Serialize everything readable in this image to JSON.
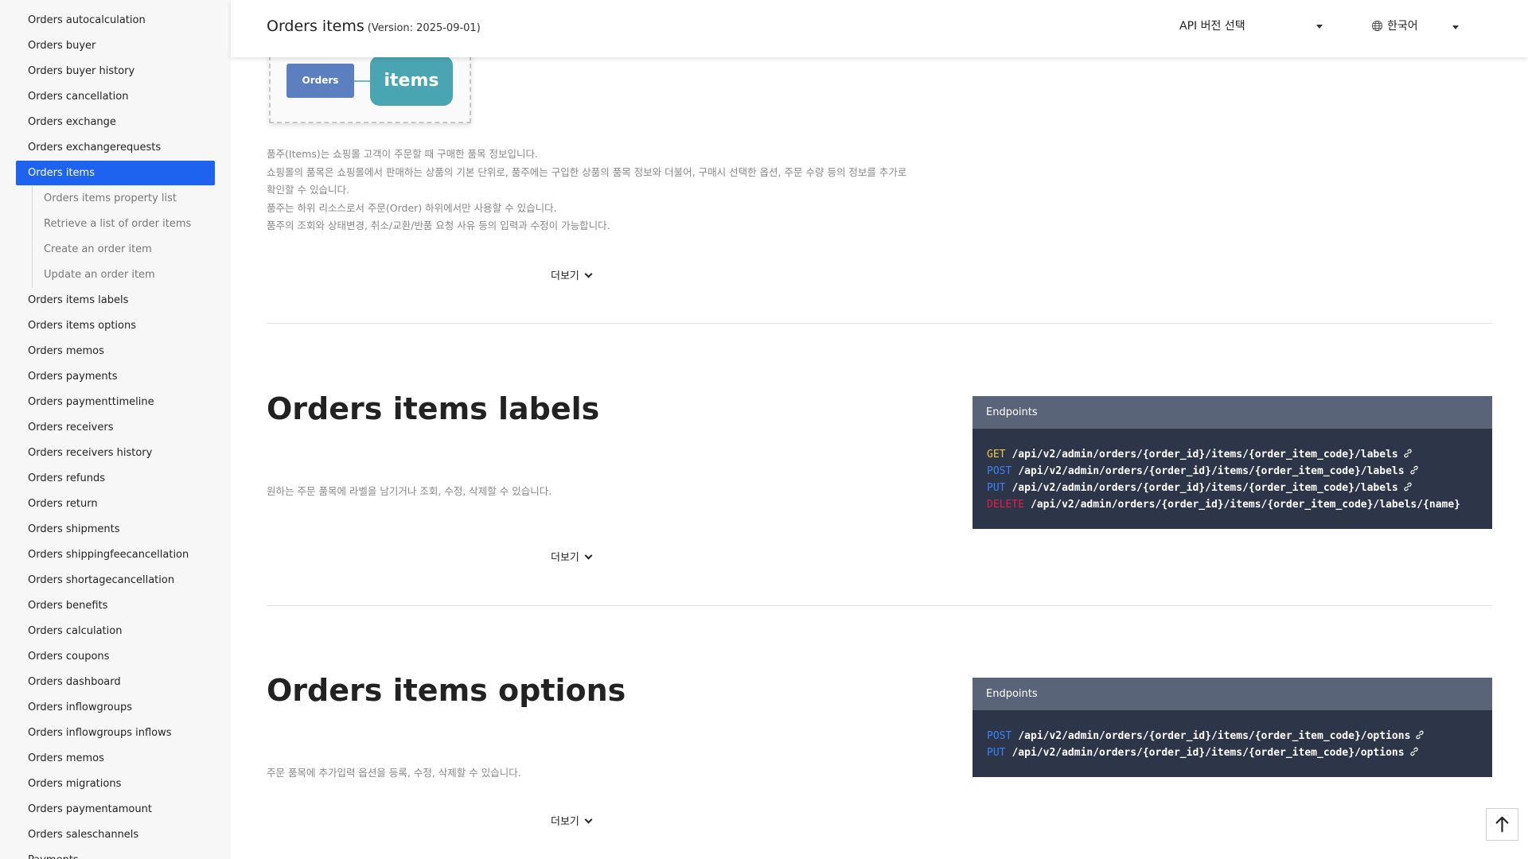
{
  "sidebar": {
    "items_before": [
      "Orders autocalculation",
      "Orders buyer",
      "Orders buyer history",
      "Orders cancellation",
      "Orders exchange",
      "Orders exchangerequests"
    ],
    "active_item": "Orders items",
    "sub_items": [
      "Orders items property list",
      "Retrieve a list of order items",
      "Create an order item",
      "Update an order item"
    ],
    "items_after": [
      "Orders items labels",
      "Orders items options",
      "Orders memos",
      "Orders payments",
      "Orders paymenttimeline",
      "Orders receivers",
      "Orders receivers history",
      "Orders refunds",
      "Orders return",
      "Orders shipments",
      "Orders shippingfeecancellation",
      "Orders shortagecancellation",
      "Orders benefits",
      "Orders calculation",
      "Orders coupons",
      "Orders dashboard",
      "Orders inflowgroups",
      "Orders inflowgroups inflows",
      "Orders memos",
      "Orders migrations",
      "Orders paymentamount",
      "Orders saleschannels",
      "Payments"
    ]
  },
  "header": {
    "title": "Orders items",
    "version": "(Version: 2025-09-01)",
    "api_select_label": "API 버전 선택",
    "language_label": "한국어"
  },
  "diagram": {
    "orders_label": "Orders",
    "items_label": "items"
  },
  "items_section": {
    "description_lines": [
      "품주(Items)는 쇼핑몰 고객이 주문할 때 구매한 품목 정보입니다.",
      "쇼핑몰의 품목은 쇼핑몰에서 판매하는 상품의 기본 단위로, 품주에는 구입한 상품의 품목 정보와 더불어, 구매시 선택한 옵션, 주문 수량 등의 정보를 추가로",
      "확인할 수 있습니다.",
      "품주는 하위 리소스로서 주문(Order) 하위에서만 사용할 수 있습니다.",
      "품주의 조회와 상태변경, 취소/교환/반품 요청 사유 등의 입력과 수정이 가능합니다."
    ],
    "more_label": "더보기"
  },
  "labels_section": {
    "title": "Orders items labels",
    "description": "원하는 주문 품목에 라벨을 남기거나 조회, 수정, 삭제할 수 있습니다.",
    "more_label": "더보기",
    "endpoints_title": "Endpoints",
    "endpoints": [
      {
        "method": "GET",
        "path": "/api/v2/admin/orders/{order_id}/items/{order_item_code}/labels"
      },
      {
        "method": "POST",
        "path": "/api/v2/admin/orders/{order_id}/items/{order_item_code}/labels"
      },
      {
        "method": "PUT",
        "path": "/api/v2/admin/orders/{order_id}/items/{order_item_code}/labels"
      },
      {
        "method": "DELETE",
        "path": "/api/v2/admin/orders/{order_id}/items/{order_item_code}/labels/{name}"
      }
    ]
  },
  "options_section": {
    "title": "Orders items options",
    "description": "주문 품목에 추가입력 옵션을 등록, 수정, 삭제할 수 있습니다.",
    "more_label": "더보기",
    "endpoints_title": "Endpoints",
    "endpoints": [
      {
        "method": "POST",
        "path": "/api/v2/admin/orders/{order_id}/items/{order_item_code}/options"
      },
      {
        "method": "PUT",
        "path": "/api/v2/admin/orders/{order_id}/items/{order_item_code}/options"
      }
    ]
  },
  "colors": {
    "accent": "#1e63f0",
    "endpoint_panel": "#2c3648",
    "method_get": "#f5c542",
    "method_post": "#3b82f6",
    "method_delete": "#e11d48"
  },
  "icons": {
    "language": "globe-icon",
    "endpoint_link": "link-icon",
    "more": "chevron-down-icon",
    "scroll_top": "arrow-up-icon"
  }
}
